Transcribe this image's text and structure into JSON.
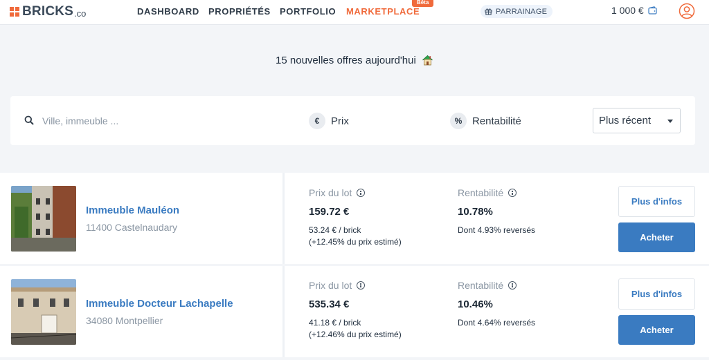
{
  "nav": {
    "logo": "BRICKS",
    "logo_suffix": ".co",
    "items": [
      {
        "label": "DASHBOARD"
      },
      {
        "label": "PROPRIÉTÉS"
      },
      {
        "label": "PORTFOLIO"
      },
      {
        "label": "MARKETPLACE"
      }
    ],
    "beta_badge": "Bêta",
    "parrainage": "PARRAINAGE",
    "balance": "1 000 €"
  },
  "headline": "15 nouvelles offres aujourd'hui",
  "filters": {
    "search_placeholder": "Ville, immeuble ...",
    "price_icon": "€",
    "price_label": "Prix",
    "yield_icon": "%",
    "yield_label": "Rentabilité",
    "sort_value": "Plus récent"
  },
  "listings": [
    {
      "name": "Immeuble Mauléon",
      "city": "11400 Castelnaudary",
      "price_label": "Prix du lot",
      "price": "159.72 €",
      "per_brick": "53.24 € / brick",
      "vs_estimate": "(+12.45% du prix estimé)",
      "yield_label": "Rentabilité",
      "yield": "10.78%",
      "distributed": "Dont 4.93% reversés",
      "info_button": "Plus d'infos",
      "buy_button": "Acheter"
    },
    {
      "name": "Immeuble Docteur Lachapelle",
      "city": "34080 Montpellier",
      "price_label": "Prix du lot",
      "price": "535.34 €",
      "per_brick": "41.18 € / brick",
      "vs_estimate": "(+12.46% du prix estimé)",
      "yield_label": "Rentabilité",
      "yield": "10.46%",
      "distributed": "Dont 4.64% reversés",
      "info_button": "Plus d'infos",
      "buy_button": "Acheter"
    }
  ],
  "colors": {
    "accent": "#f06a3b",
    "primary": "#3a7bc1",
    "background": "#f3f5f8"
  }
}
